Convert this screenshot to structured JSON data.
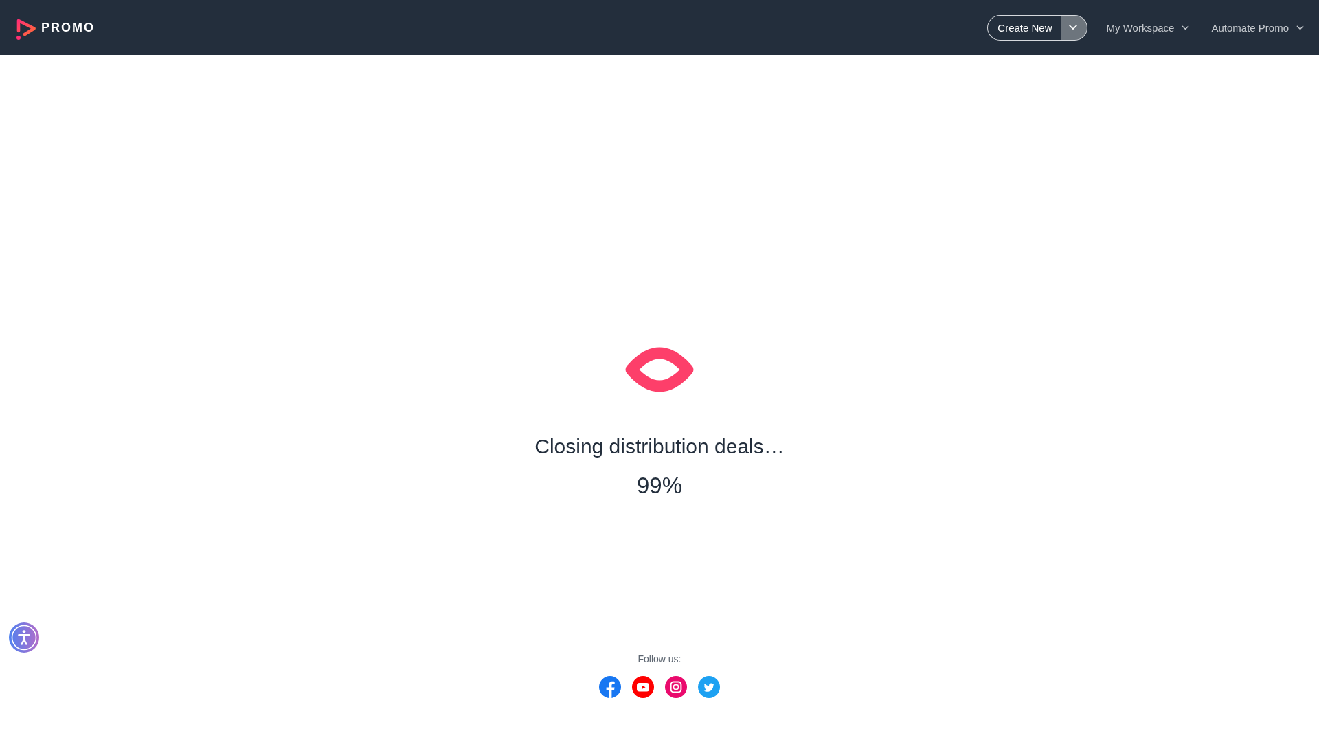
{
  "header": {
    "logo_text": "PROMO",
    "create_button": "Create New",
    "nav": [
      {
        "label": "My Workspace"
      },
      {
        "label": "Automate Promo"
      }
    ]
  },
  "loader": {
    "message": "Closing distribution deals…",
    "percent": "99%"
  },
  "footer": {
    "follow_label": "Follow us:",
    "social": [
      {
        "kind": "facebook"
      },
      {
        "kind": "youtube"
      },
      {
        "kind": "instagram"
      },
      {
        "kind": "twitter"
      }
    ]
  }
}
